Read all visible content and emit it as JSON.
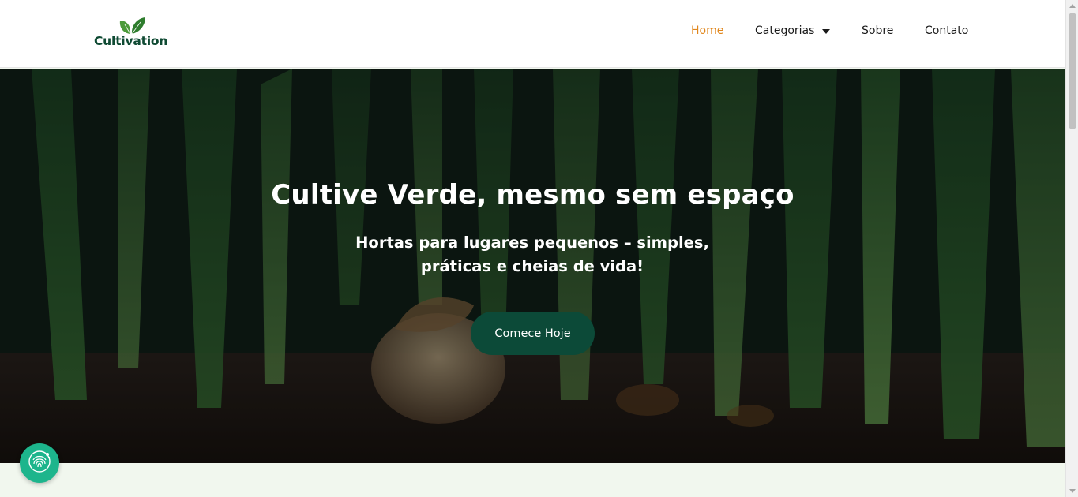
{
  "header": {
    "logo_text": "Cultivation",
    "nav": [
      {
        "label": "Home",
        "active": true
      },
      {
        "label": "Categorias",
        "has_dropdown": true
      },
      {
        "label": "Sobre"
      },
      {
        "label": "Contato"
      }
    ]
  },
  "hero": {
    "title": "Cultive Verde, mesmo sem espaço",
    "subtitle": "Hortas para lugares pequenos – simples, práticas e cheias de vida!",
    "cta_label": "Comece Hoje"
  },
  "icons": {
    "logo": "leaf-icon",
    "accessibility": "fingerprint-icon",
    "dropdown": "caret-down-icon"
  },
  "colors": {
    "brand": "#0f4a33",
    "accent": "#e0861c",
    "cta": "#0c4a38",
    "accessibility": "#1db58c"
  }
}
